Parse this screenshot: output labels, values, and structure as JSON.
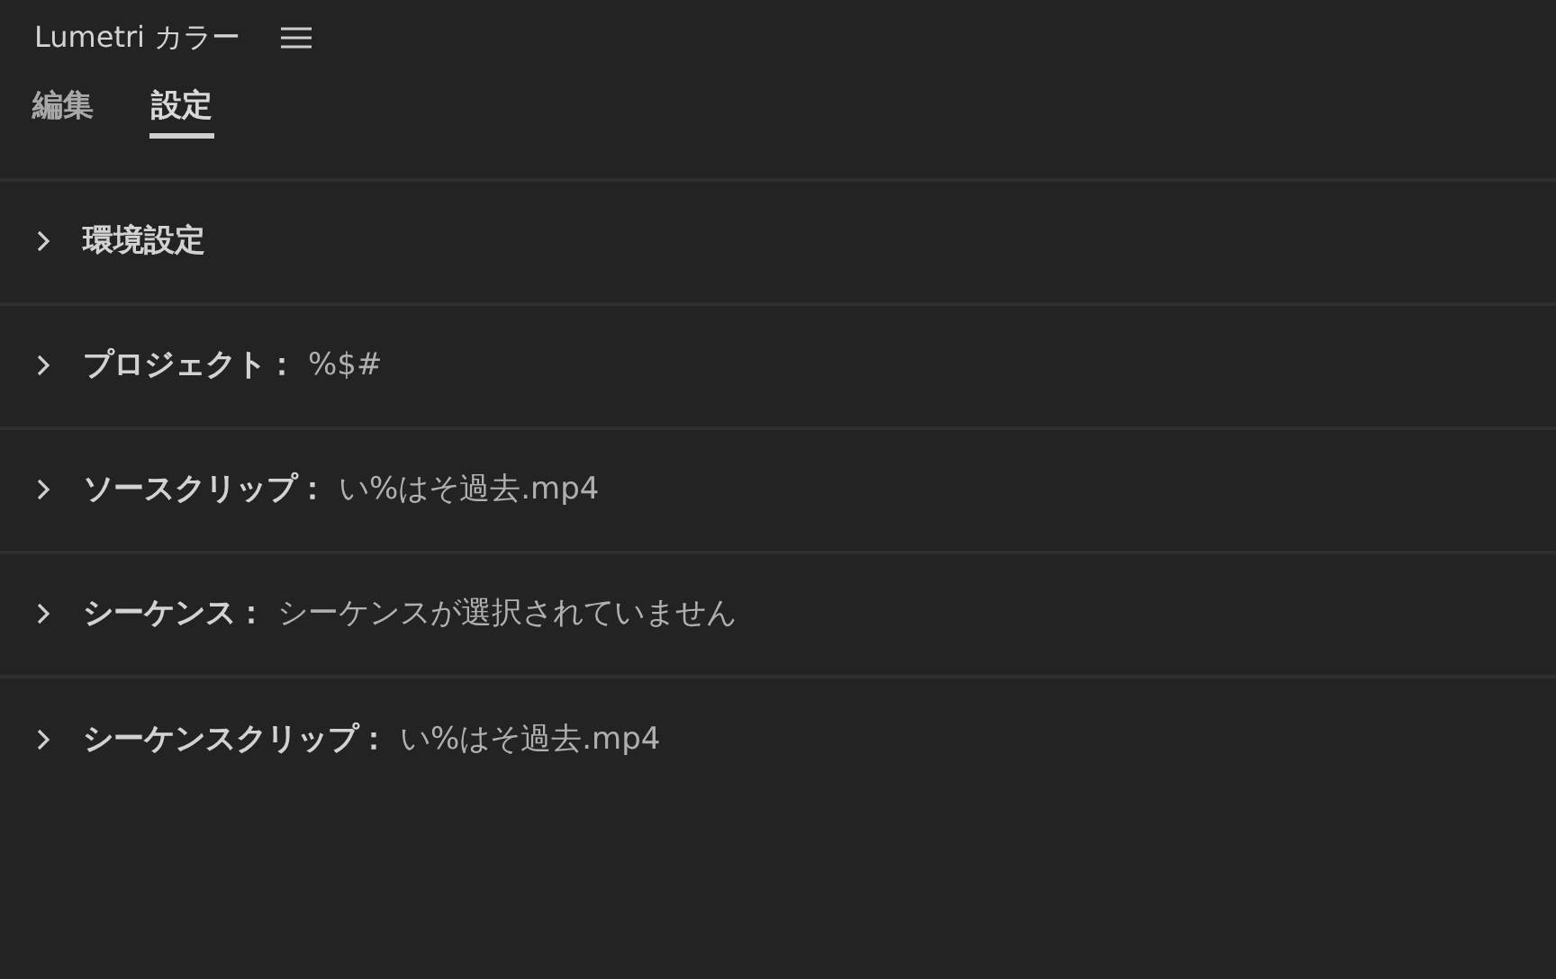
{
  "panel": {
    "title": "Lumetri カラー"
  },
  "tabs": [
    {
      "label": "編集",
      "selected": false
    },
    {
      "label": "設定",
      "selected": true
    }
  ],
  "sections": [
    {
      "label": "環境設定",
      "expanded": false
    },
    {
      "label": "プロジェクト：",
      "value": "%$#",
      "expanded": false
    },
    {
      "label": "ソースクリップ：",
      "value": "い%はそ過去.mp4",
      "expanded": false
    },
    {
      "label": "シーケンス：",
      "value": "シーケンスが選択されていません",
      "expanded": false
    },
    {
      "label": "シーケンスクリップ：",
      "value": "い%はそ過去.mp4",
      "expanded": false
    }
  ]
}
